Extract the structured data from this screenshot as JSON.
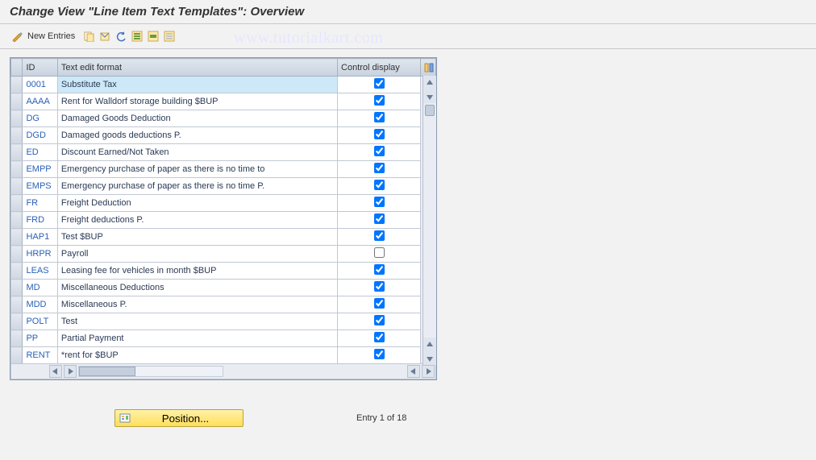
{
  "title": "Change View \"Line Item Text Templates\": Overview",
  "watermark": "www.tutorialkart.com",
  "toolbar": {
    "new_entries_label": "New Entries"
  },
  "table": {
    "headers": {
      "id": "ID",
      "text": "Text edit format",
      "control": "Control display"
    },
    "rows": [
      {
        "id": "0001",
        "text": "Substitute Tax",
        "control": true,
        "selected": true
      },
      {
        "id": "AAAA",
        "text": "Rent for Walldorf storage building $BUP",
        "control": true
      },
      {
        "id": "DG",
        "text": "Damaged Goods Deduction",
        "control": true
      },
      {
        "id": "DGD",
        "text": "Damaged goods deductions P.",
        "control": true
      },
      {
        "id": "ED",
        "text": "Discount Earned/Not Taken",
        "control": true
      },
      {
        "id": "EMPP",
        "text": "Emergency purchase of paper as there is no time to",
        "control": true
      },
      {
        "id": "EMPS",
        "text": "Emergency purchase of paper as there is no time P.",
        "control": true
      },
      {
        "id": "FR",
        "text": "Freight Deduction",
        "control": true
      },
      {
        "id": "FRD",
        "text": "Freight deductions P.",
        "control": true
      },
      {
        "id": "HAP1",
        "text": "Test $BUP",
        "control": true
      },
      {
        "id": "HRPR",
        "text": "Payroll",
        "control": false
      },
      {
        "id": "LEAS",
        "text": "Leasing fee for vehicles in month $BUP",
        "control": true
      },
      {
        "id": "MD",
        "text": "Miscellaneous Deductions",
        "control": true
      },
      {
        "id": "MDD",
        "text": "Miscellaneous P.",
        "control": true
      },
      {
        "id": "POLT",
        "text": "Test",
        "control": true
      },
      {
        "id": "PP",
        "text": "Partial Payment",
        "control": true
      },
      {
        "id": "RENT",
        "text": "*rent for $BUP",
        "control": true
      }
    ]
  },
  "footer": {
    "position_label": "Position...",
    "entry_text": "Entry 1 of 18"
  }
}
